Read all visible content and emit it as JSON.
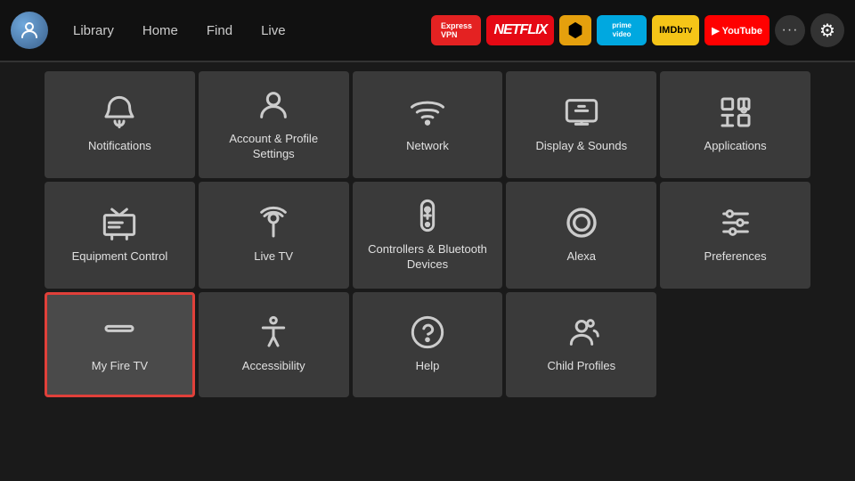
{
  "nav": {
    "avatar_label": "User Avatar",
    "links": [
      "Library",
      "Home",
      "Find",
      "Live"
    ],
    "apps": [
      {
        "name": "ExpressVPN",
        "class": "app-expressvpn",
        "label": "ExpressVPN"
      },
      {
        "name": "Netflix",
        "class": "app-netflix",
        "label": "NETFLIX"
      },
      {
        "name": "Plex",
        "class": "app-plex",
        "label": "▶"
      },
      {
        "name": "Prime Video",
        "class": "app-prime",
        "label": "prime video"
      },
      {
        "name": "IMDb TV",
        "class": "app-imdb",
        "label": "IMDbTV"
      },
      {
        "name": "YouTube",
        "class": "app-youtube",
        "label": "▶ YouTube"
      }
    ],
    "more_label": "•••",
    "settings_label": "⚙"
  },
  "settings": {
    "tiles": [
      {
        "id": "notifications",
        "label": "Notifications",
        "icon": "bell",
        "focused": false
      },
      {
        "id": "account",
        "label": "Account & Profile Settings",
        "icon": "person",
        "focused": false
      },
      {
        "id": "network",
        "label": "Network",
        "icon": "wifi",
        "focused": false
      },
      {
        "id": "display",
        "label": "Display & Sounds",
        "icon": "display",
        "focused": false
      },
      {
        "id": "applications",
        "label": "Applications",
        "icon": "apps",
        "focused": false
      },
      {
        "id": "equipment",
        "label": "Equipment Control",
        "icon": "tv",
        "focused": false
      },
      {
        "id": "livetv",
        "label": "Live TV",
        "icon": "antenna",
        "focused": false
      },
      {
        "id": "controllers",
        "label": "Controllers & Bluetooth Devices",
        "icon": "remote",
        "focused": false
      },
      {
        "id": "alexa",
        "label": "Alexa",
        "icon": "alexa",
        "focused": false
      },
      {
        "id": "preferences",
        "label": "Preferences",
        "icon": "sliders",
        "focused": false
      },
      {
        "id": "myfiretv",
        "label": "My Fire TV",
        "icon": "firetv",
        "focused": true
      },
      {
        "id": "accessibility",
        "label": "Accessibility",
        "icon": "accessibility",
        "focused": false
      },
      {
        "id": "help",
        "label": "Help",
        "icon": "help",
        "focused": false
      },
      {
        "id": "childprofiles",
        "label": "Child Profiles",
        "icon": "childprofiles",
        "focused": false
      }
    ]
  }
}
